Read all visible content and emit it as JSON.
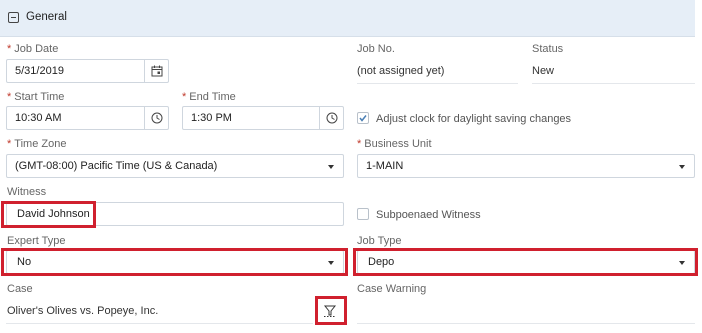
{
  "section": {
    "title": "General"
  },
  "labels": {
    "job_date": "Job Date",
    "job_no": "Job No.",
    "status": "Status",
    "start_time": "Start Time",
    "end_time": "End Time",
    "time_zone": "Time Zone",
    "business_unit": "Business Unit",
    "witness": "Witness",
    "expert_type": "Expert Type",
    "job_type": "Job Type",
    "case": "Case",
    "case_warning": "Case Warning"
  },
  "required_marker": "*",
  "values": {
    "job_date": "5/31/2019",
    "job_no": "(not assigned yet)",
    "status": "New",
    "start_time": "10:30 AM",
    "end_time": "1:30 PM",
    "dst_label": "Adjust clock for daylight saving changes",
    "dst_checked": true,
    "time_zone": "(GMT-08:00) Pacific Time (US & Canada)",
    "business_unit": "1-MAIN",
    "witness": "David Johnson",
    "subpoenaed_label": "Subpoenaed Witness",
    "subpoenaed_checked": false,
    "expert_type": "No",
    "job_type": "Depo",
    "case": "Oliver's Olives vs. Popeye, Inc.",
    "case_warning": ""
  },
  "icons": {
    "collapse": "minus-square-icon",
    "calendar": "calendar-icon",
    "clock": "clock-icon",
    "check": "check-icon",
    "caret": "caret-down-icon",
    "filter": "filter-icon"
  },
  "colors": {
    "header_bg": "#e6eef7",
    "required": "#c0392b",
    "highlight": "#d0202e",
    "border": "#cfd6de"
  }
}
